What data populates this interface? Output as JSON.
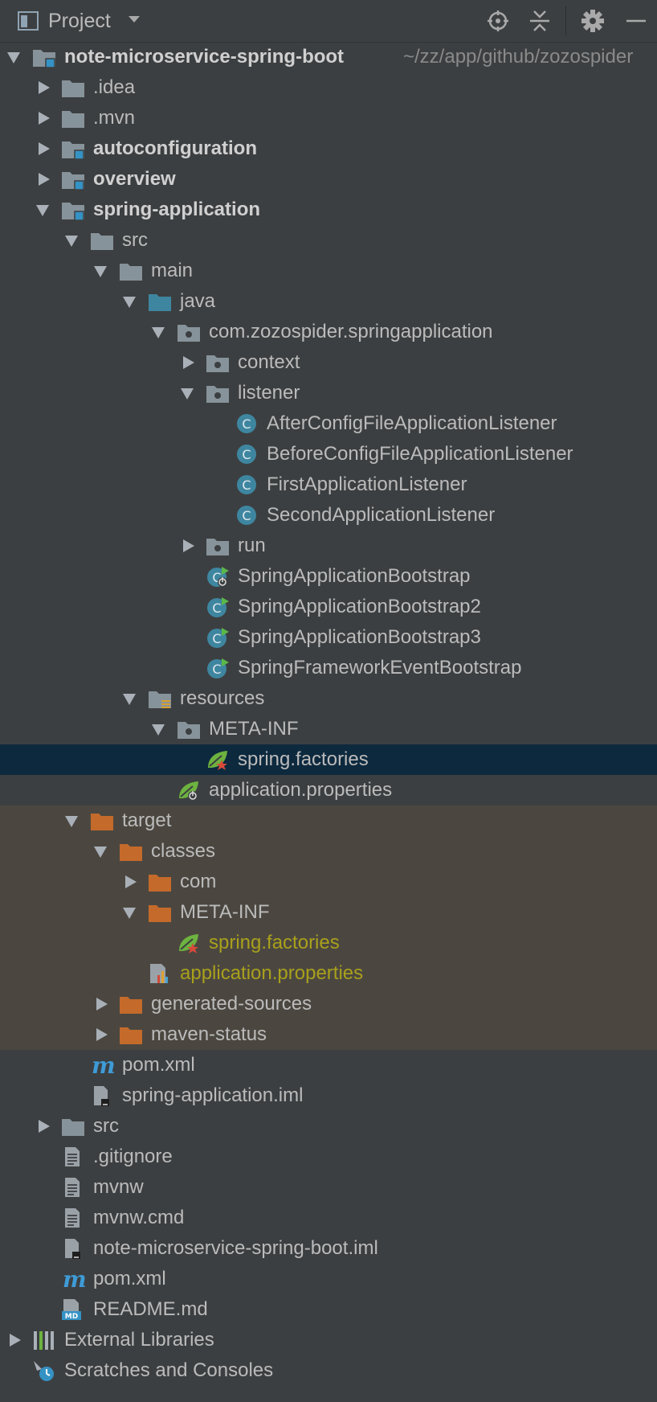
{
  "header": {
    "title": "Project",
    "icons": [
      "project-panel-icon",
      "dropdown-caret-icon",
      "locate-icon",
      "collapse-all-icon",
      "gear-icon",
      "hide-icon"
    ]
  },
  "colors": {
    "panel_bg": "#3c3f41",
    "selected_row": "#0d293e",
    "excluded_row": "#4b4740",
    "folder_gray": "#87939a",
    "folder_orange": "#c46a2b",
    "source_blue": "#3e86a0",
    "generated_text": "#a9a01c"
  },
  "tree": {
    "root": {
      "label": "note-microservice-spring-boot",
      "path": "~/zz/app/github/zozospider"
    },
    "idea": ".idea",
    "mvn": ".mvn",
    "autoconfiguration": "autoconfiguration",
    "overview": "overview",
    "spring_application": "spring-application",
    "src": "src",
    "main": "main",
    "java": "java",
    "package": "com.zozospider.springapplication",
    "context": "context",
    "listener": "listener",
    "listener_classes": [
      "AfterConfigFileApplicationListener",
      "BeforeConfigFileApplicationListener",
      "FirstApplicationListener",
      "SecondApplicationListener"
    ],
    "run": "run",
    "bootstraps": [
      "SpringApplicationBootstrap",
      "SpringApplicationBootstrap2",
      "SpringApplicationBootstrap3",
      "SpringFrameworkEventBootstrap"
    ],
    "resources": "resources",
    "meta_inf": "META-INF",
    "spring_factories": "spring.factories",
    "application_properties": "application.properties",
    "target": "target",
    "classes": "classes",
    "com": "com",
    "target_meta_inf": "META-INF",
    "target_spring_factories": "spring.factories",
    "target_application_properties": "application.properties",
    "generated_sources": "generated-sources",
    "maven_status": "maven-status",
    "module_pom": "pom.xml",
    "module_iml": "spring-application.iml",
    "root_src": "src",
    "gitignore": ".gitignore",
    "mvnw": "mvnw",
    "mvnw_cmd": "mvnw.cmd",
    "root_iml": "note-microservice-spring-boot.iml",
    "root_pom": "pom.xml",
    "readme": "README.md",
    "external_libraries": "External Libraries",
    "scratches": "Scratches and Consoles"
  }
}
